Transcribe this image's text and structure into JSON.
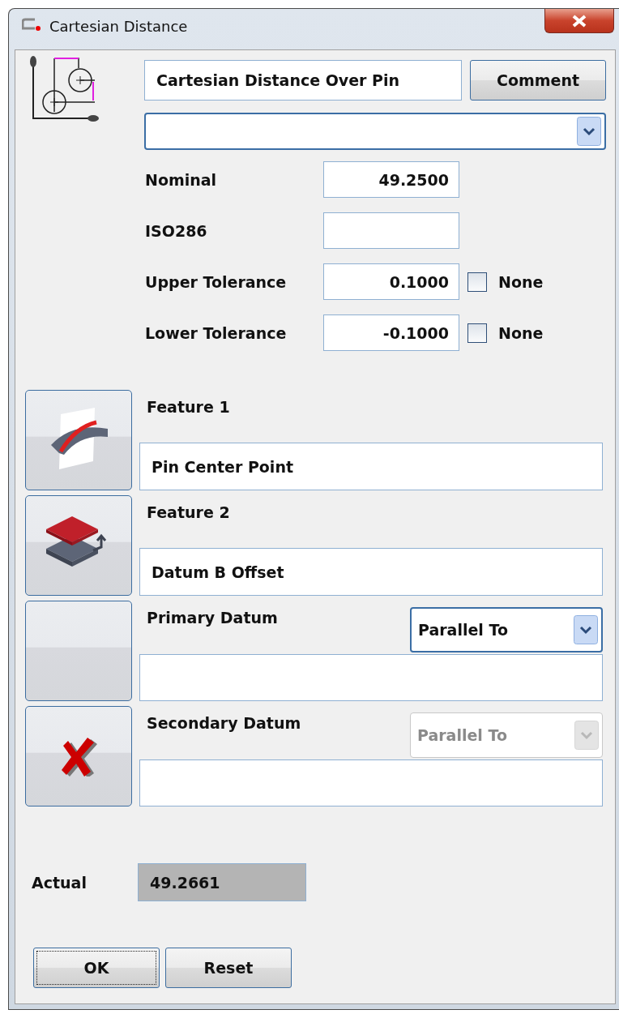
{
  "window": {
    "title": "Cartesian Distance"
  },
  "name_field": {
    "value": "Cartesian Distance Over Pin"
  },
  "comment_button": {
    "label": "Comment"
  },
  "type_dropdown": {
    "disabled": false
  },
  "tolerances": [
    {
      "label": "Nominal",
      "value": "49.2500"
    },
    {
      "label": "ISO286"
    },
    {
      "label": "Upper Tolerance",
      "value": "0.1000",
      "none_option": {
        "label": "None",
        "checked": false
      }
    },
    {
      "label": "Lower Tolerance",
      "value": "-0.1000",
      "none_option": {
        "label": "None",
        "checked": false
      }
    }
  ],
  "features": [
    {
      "label": "Feature 1",
      "kind": "curve",
      "value": "Pin Center Point"
    },
    {
      "label": "Feature 2",
      "kind": "offset",
      "value": "Datum B Offset"
    },
    {
      "label": "Primary Datum",
      "kind": "blank",
      "relation": {
        "value": "Parallel To",
        "disabled": false
      }
    },
    {
      "label": "Secondary Datum",
      "kind": "delete",
      "relation": {
        "value": "Parallel To",
        "disabled": true
      }
    }
  ],
  "actual": {
    "label": "Actual",
    "value": "49.2661"
  },
  "buttons": [
    {
      "label": "OK",
      "default": true
    },
    {
      "label": "Reset",
      "default": false
    }
  ]
}
